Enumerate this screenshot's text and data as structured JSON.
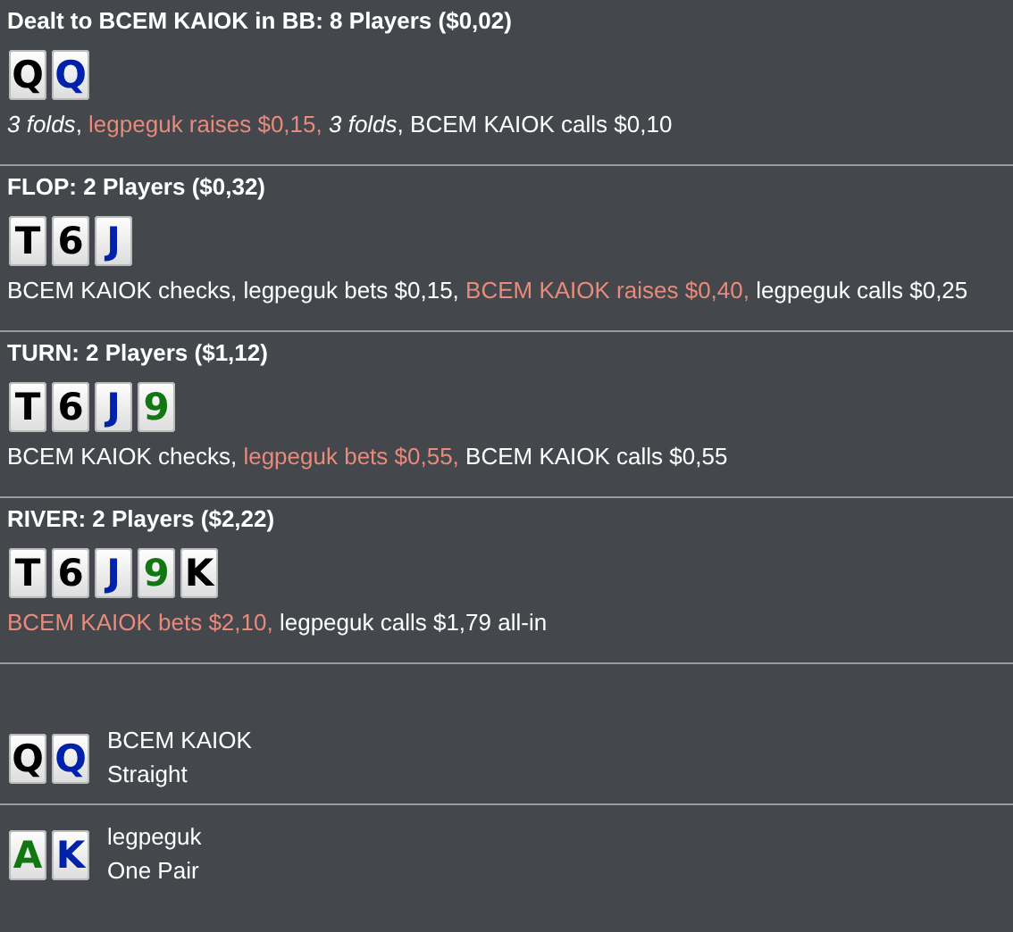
{
  "streets": [
    {
      "title": "Dealt to BCEM KAIOK in BB: 8 Players ($0,02)",
      "cards": [
        {
          "rank": "Q",
          "color": "#000000"
        },
        {
          "rank": "Q",
          "color": "#0022aa"
        }
      ],
      "actions": [
        {
          "text": "*3 folds*, ",
          "highlight": false
        },
        {
          "text": "legpeguk raises $0,15, ",
          "highlight": true
        },
        {
          "text": "*3 folds*, ",
          "highlight": false
        },
        {
          "text": "BCEM KAIOK calls $0,10",
          "highlight": false
        }
      ]
    },
    {
      "title": "FLOP: 2 Players ($0,32)",
      "cards": [
        {
          "rank": "T",
          "color": "#000000"
        },
        {
          "rank": "6",
          "color": "#000000"
        },
        {
          "rank": "J",
          "color": "#0022aa"
        }
      ],
      "actions": [
        {
          "text": "BCEM KAIOK checks, legpeguk bets $0,15, ",
          "highlight": false
        },
        {
          "text": "BCEM KAIOK raises $0,40, ",
          "highlight": true
        },
        {
          "text": "legpeguk calls $0,25",
          "highlight": false
        }
      ]
    },
    {
      "title": "TURN: 2 Players ($1,12)",
      "cards": [
        {
          "rank": "T",
          "color": "#000000"
        },
        {
          "rank": "6",
          "color": "#000000"
        },
        {
          "rank": "J",
          "color": "#0022aa"
        },
        {
          "rank": "9",
          "color": "#117711"
        }
      ],
      "actions": [
        {
          "text": "BCEM KAIOK checks, ",
          "highlight": false
        },
        {
          "text": "legpeguk bets $0,55, ",
          "highlight": true
        },
        {
          "text": "BCEM KAIOK calls $0,55",
          "highlight": false
        }
      ]
    },
    {
      "title": "RIVER: 2 Players ($2,22)",
      "cards": [
        {
          "rank": "T",
          "color": "#000000"
        },
        {
          "rank": "6",
          "color": "#000000"
        },
        {
          "rank": "J",
          "color": "#0022aa"
        },
        {
          "rank": "9",
          "color": "#117711"
        },
        {
          "rank": "K",
          "color": "#000000"
        }
      ],
      "actions": [
        {
          "text": "BCEM KAIOK bets $2,10, ",
          "highlight": true
        },
        {
          "text": "legpeguk calls $1,79 all-in",
          "highlight": false
        }
      ]
    }
  ],
  "showdown": [
    {
      "player": "BCEM KAIOK",
      "hand": "Straight",
      "cards": [
        {
          "rank": "Q",
          "color": "#000000"
        },
        {
          "rank": "Q",
          "color": "#0022aa"
        }
      ]
    },
    {
      "player": "legpeguk",
      "hand": "One Pair",
      "cards": [
        {
          "rank": "A",
          "color": "#117711"
        },
        {
          "rank": "K",
          "color": "#0022aa"
        }
      ]
    }
  ]
}
